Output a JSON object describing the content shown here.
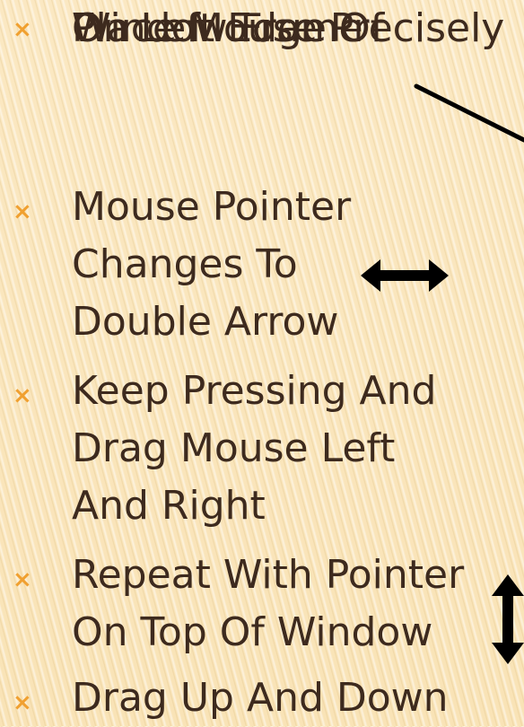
{
  "bullets": [
    {
      "lines": [
        "Place Mouse Precisely",
        "On Left Edge Of",
        "Window Frame"
      ]
    },
    {
      "lines": [
        "Mouse Pointer",
        "Changes To",
        "Double Arrow"
      ]
    },
    {
      "lines": [
        "Keep Pressing And",
        "Drag Mouse Left",
        "And Right"
      ]
    },
    {
      "lines": [
        "Repeat With Pointer",
        "On Top Of Window"
      ]
    },
    {
      "lines": [
        "Drag Up And Down"
      ]
    }
  ],
  "marker_glyph": "×",
  "colors": {
    "text": "#3d2a1e",
    "marker": "#f0a030",
    "background": "#fbe7bf",
    "arrow": "#000000"
  },
  "icons": {
    "pointer_line": "pointer-line-icon",
    "horizontal_arrow": "horizontal-double-arrow-icon",
    "vertical_arrow": "vertical-double-arrow-icon"
  }
}
